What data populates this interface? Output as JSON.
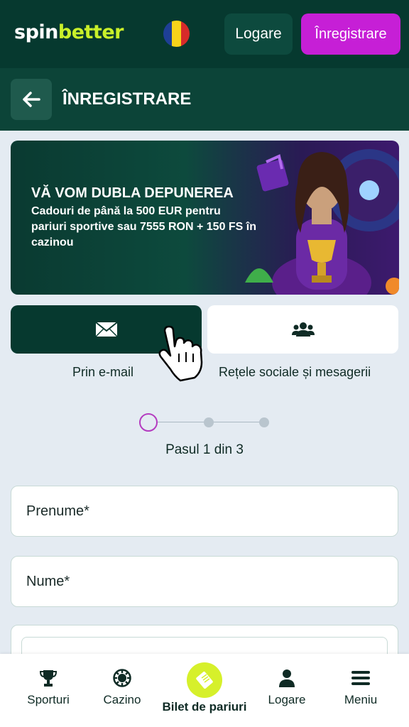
{
  "header": {
    "logo_part1": "spin",
    "logo_part2": "better",
    "flag_icon": "romania-flag-icon",
    "login_label": "Logare",
    "register_label": "Înregistrare"
  },
  "subheader": {
    "title": "ÎNREGISTRARE"
  },
  "banner": {
    "title": "VĂ VOM DUBLA DEPUNEREA",
    "text": "Cadouri de până la 500 EUR pentru pariuri sportive sau 7555 RON + 150 FS în cazinou"
  },
  "tabs": {
    "email_label": "Prin e-mail",
    "social_label": "Rețele sociale și mesagerii"
  },
  "stepper": {
    "label": "Pasul 1 din 3",
    "current": 1,
    "total": 3
  },
  "form": {
    "first_name_placeholder": "Prenume*",
    "last_name_placeholder": "Nume*"
  },
  "bottom_nav": {
    "items": [
      {
        "label": "Sporturi",
        "icon": "trophy-icon"
      },
      {
        "label": "Cazino",
        "icon": "casino-chip-icon"
      },
      {
        "label": "Bilet de pariuri",
        "icon": "ticket-icon"
      },
      {
        "label": "Logare",
        "icon": "user-icon"
      },
      {
        "label": "Meniu",
        "icon": "menu-icon"
      }
    ]
  },
  "colors": {
    "header_bg": "#06392f",
    "subheader_bg": "#0c4438",
    "accent_purple": "#c61fd6",
    "accent_lime": "#d6f02b",
    "page_bg": "#e4ebf2"
  }
}
